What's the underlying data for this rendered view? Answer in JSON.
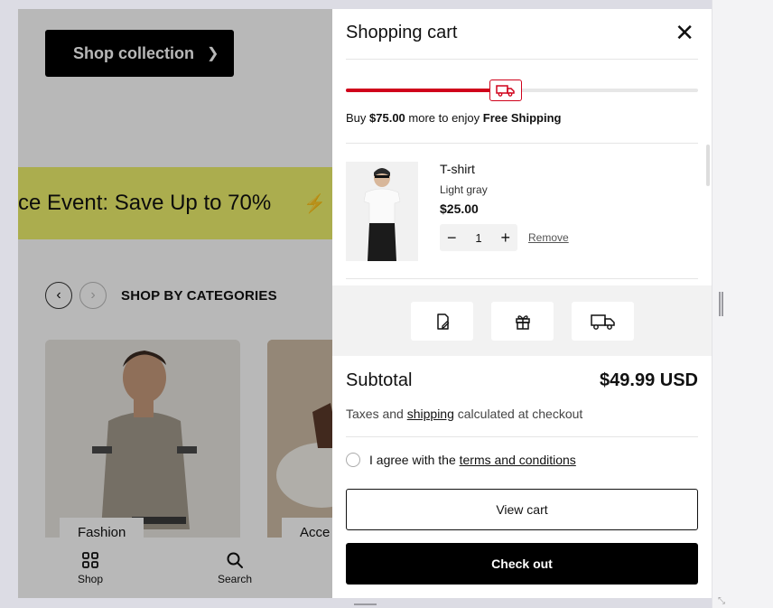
{
  "store": {
    "hero_button_label": "Shop collection",
    "marquee_text": "ce Event: Save Up to 70%",
    "categories_title": "SHOP BY CATEGORIES",
    "category_cards": [
      "Fashion",
      "Acce"
    ],
    "bottom_nav": [
      {
        "label": "Shop",
        "icon": "grid-icon"
      },
      {
        "label": "Search",
        "icon": "search-icon"
      }
    ]
  },
  "cart": {
    "title": "Shopping cart",
    "shipping_progress": 0.45,
    "shipping_msg_prefix": "Buy ",
    "shipping_amount": "$75.00",
    "shipping_msg_mid": " more to enjoy ",
    "shipping_msg_bold": "Free Shipping",
    "item": {
      "name": "T-shirt",
      "variant": "Light gray",
      "price": "$25.00",
      "quantity": "1",
      "remove_label": "Remove"
    },
    "tools": [
      "note-icon",
      "gift-icon",
      "truck-icon"
    ],
    "subtotal_label": "Subtotal",
    "subtotal_value": "$49.99 USD",
    "tax_prefix": "Taxes and ",
    "tax_link": "shipping",
    "tax_suffix": " calculated at checkout",
    "agree_prefix": "I agree with the ",
    "agree_link": "terms and conditions",
    "view_cart_label": "View cart",
    "checkout_label": "Check out"
  },
  "colors": {
    "accent_red": "#d0021b",
    "marquee_yellow": "#eef06c",
    "button_black": "#000000"
  }
}
